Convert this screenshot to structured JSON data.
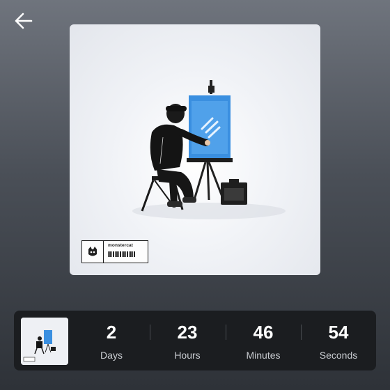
{
  "nav": {
    "back_icon": "arrow-left-icon"
  },
  "artwork": {
    "label_text": "monstercat",
    "logo_icon": "monstercat-logo-icon"
  },
  "countdown": {
    "units": [
      {
        "value": "2",
        "label": "Days"
      },
      {
        "value": "23",
        "label": "Hours"
      },
      {
        "value": "46",
        "label": "Minutes"
      },
      {
        "value": "54",
        "label": "Seconds"
      }
    ]
  },
  "colors": {
    "background_top": "#6f747d",
    "background_bottom": "#2e3238",
    "bar_background": "#1b1d20",
    "canvas_blue": "#3a8fe0"
  }
}
